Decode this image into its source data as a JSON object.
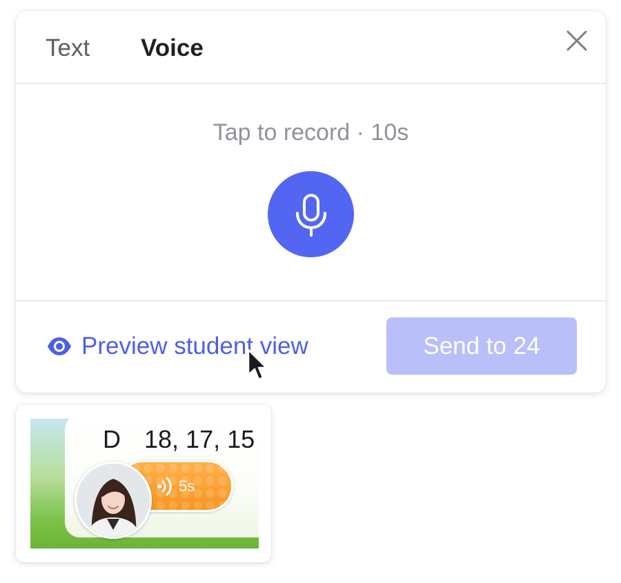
{
  "tabs": [
    {
      "label": "Text",
      "active": false
    },
    {
      "label": "Voice",
      "active": true
    }
  ],
  "record": {
    "hint": "Tap to record · 10s",
    "accent_color": "#5366f2"
  },
  "footer": {
    "preview_label": "Preview student view",
    "send_label": "Send to 24",
    "send_enabled": false,
    "send_color": "#b8bff9"
  },
  "thumbnail": {
    "heading_letter": "D",
    "heading_numbers": "18, 17, 15",
    "voice_length": "5s",
    "pill_color": "#f79522"
  },
  "icons": {
    "close": "close-icon",
    "mic": "microphone-icon",
    "preview": "eye-icon",
    "voice": "sound-wave-icon"
  }
}
